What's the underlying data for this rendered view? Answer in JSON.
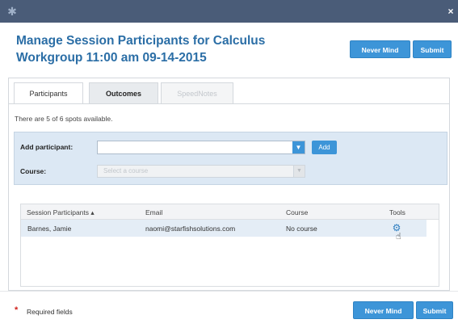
{
  "window": {
    "logo_icon": "star-logo-icon",
    "close_glyph": "×"
  },
  "dialog": {
    "title": "Manage Session Participants for Calculus Workgroup 11:00 am 09-14-2015",
    "never_mind_label": "Never Mind",
    "submit_label": "Submit"
  },
  "tabs": [
    {
      "label": "Participants",
      "active": true
    },
    {
      "label": "Outcomes",
      "active": false
    },
    {
      "label": "SpeedNotes",
      "active": false,
      "disabled": true
    }
  ],
  "spots_text": "There are 5 of 6 spots available.",
  "add_form": {
    "participant_label": "Add participant:",
    "participant_value": "",
    "add_button_label": "Add",
    "course_label": "Course:",
    "course_placeholder": "Select a course"
  },
  "table": {
    "columns": [
      "Session Participants ▴",
      "Email",
      "Course",
      "Tools"
    ],
    "rows": [
      {
        "name": "Barnes, Jamie",
        "email": "naomi@starfishsolutions.com",
        "course": "No course",
        "tool_icon": "gear-icon"
      }
    ]
  },
  "footer": {
    "required_text": "Required fields"
  },
  "colors": {
    "accent": "#3d95d8",
    "title_blue": "#2b6ea6",
    "titlebar": "#4a5c78",
    "required_red": "#d0211c"
  }
}
